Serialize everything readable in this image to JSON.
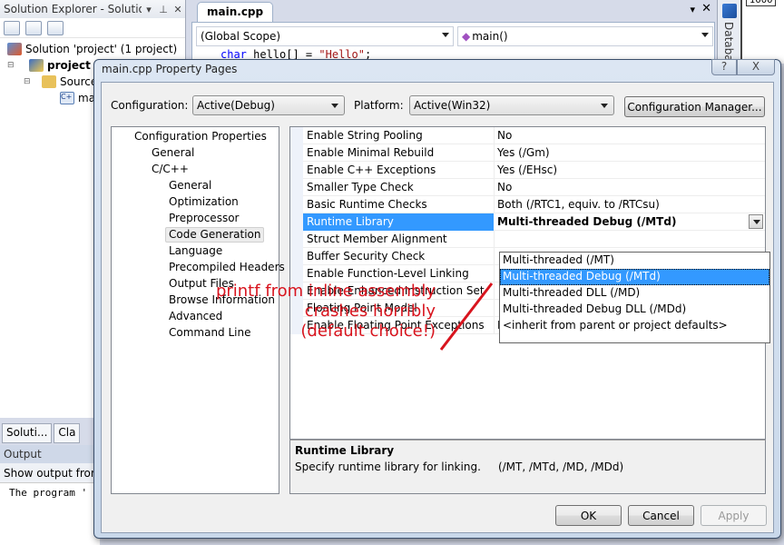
{
  "solution_explorer": {
    "title": "Solution Explorer - Solutio...",
    "tree": [
      {
        "label": "Solution 'project' (1 project)",
        "bold": false
      },
      {
        "label": "project",
        "bold": true
      },
      {
        "label": "Source",
        "bold": false
      },
      {
        "label": "ma",
        "bold": false
      }
    ]
  },
  "editor": {
    "tab": "main.cpp",
    "scope_combo": "(Global Scope)",
    "member_combo": "main()",
    "code_keyword": "char",
    "code_ident": " hello[] = ",
    "code_string": "\"Hello\"",
    "code_end": ";"
  },
  "right_strip": {
    "label": "Databa",
    "ruler": "1000"
  },
  "bottom_tabs": [
    "Soluti...",
    "Cla"
  ],
  "output": {
    "title": "Output",
    "show_from": "Show output from",
    "line": "The program '"
  },
  "dialog": {
    "title": "main.cpp Property Pages",
    "help": "?",
    "close": "X",
    "config_label": "Configuration:",
    "config_value": "Active(Debug)",
    "platform_label": "Platform:",
    "platform_value": "Active(Win32)",
    "config_manager": "Configuration Manager...",
    "nav": [
      {
        "label": "Configuration Properties",
        "level": 0
      },
      {
        "label": "General",
        "level": 1
      },
      {
        "label": "C/C++",
        "level": 1
      },
      {
        "label": "General",
        "level": 2
      },
      {
        "label": "Optimization",
        "level": 2
      },
      {
        "label": "Preprocessor",
        "level": 2
      },
      {
        "label": "Code Generation",
        "level": 2,
        "selected": true
      },
      {
        "label": "Language",
        "level": 2
      },
      {
        "label": "Precompiled Headers",
        "level": 2
      },
      {
        "label": "Output Files",
        "level": 2
      },
      {
        "label": "Browse Information",
        "level": 2
      },
      {
        "label": "Advanced",
        "level": 2
      },
      {
        "label": "Command Line",
        "level": 2
      }
    ],
    "properties": [
      {
        "name": "Enable String Pooling",
        "value": "No"
      },
      {
        "name": "Enable Minimal Rebuild",
        "value": "Yes (/Gm)"
      },
      {
        "name": "Enable C++ Exceptions",
        "value": "Yes (/EHsc)"
      },
      {
        "name": "Smaller Type Check",
        "value": "No"
      },
      {
        "name": "Basic Runtime Checks",
        "value": "Both (/RTC1, equiv. to /RTCsu)"
      },
      {
        "name": "Runtime Library",
        "value": "Multi-threaded Debug (/MTd)",
        "selected": true
      },
      {
        "name": "Struct Member Alignment",
        "value": ""
      },
      {
        "name": "Buffer Security Check",
        "value": ""
      },
      {
        "name": "Enable Function-Level Linking",
        "value": ""
      },
      {
        "name": "Enable Enhanced Instruction Set",
        "value": ""
      },
      {
        "name": "Floating Point Model",
        "value": ""
      },
      {
        "name": "Enable Floating Point Exceptions",
        "value": "No"
      }
    ],
    "dropdown_options": [
      {
        "label": "Multi-threaded (/MT)"
      },
      {
        "label": "Multi-threaded Debug (/MTd)",
        "selected": true
      },
      {
        "label": "Multi-threaded DLL (/MD)"
      },
      {
        "label": "Multi-threaded Debug DLL (/MDd)"
      },
      {
        "label": "<inherit from parent or project defaults>"
      }
    ],
    "description_title": "Runtime Library",
    "description_text": "Specify runtime library for linking.     (/MT, /MTd, /MD, /MDd)",
    "ok": "OK",
    "cancel": "Cancel",
    "apply": "Apply"
  },
  "annotation": {
    "lines": [
      "printf from inline assembly",
      "crashes horribly",
      "(default choice!)"
    ],
    "color": "#d8141e"
  }
}
